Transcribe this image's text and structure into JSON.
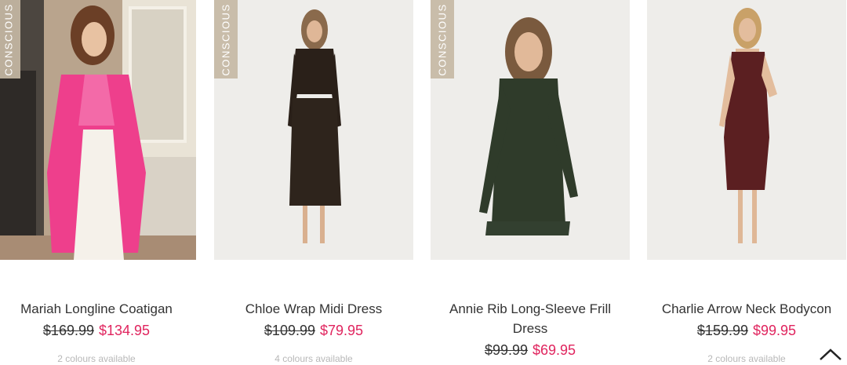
{
  "products": [
    {
      "badge": "CONSCIOUS",
      "name": "Mariah Longline Coatigan",
      "was_price": "$169.99",
      "now_price": "$134.95",
      "colours": "2 colours available",
      "image_icon": "product-photo-pink-coatigan"
    },
    {
      "badge": "CONSCIOUS",
      "name": "Chloe Wrap Midi Dress",
      "was_price": "$109.99",
      "now_price": "$79.95",
      "colours": "4 colours available",
      "image_icon": "product-photo-black-wrap-dress"
    },
    {
      "badge": "CONSCIOUS",
      "name_line1": "Annie Rib Long-Sleeve Frill",
      "name_line2": "Dress",
      "was_price": "$99.99",
      "now_price": "$69.95",
      "image_icon": "product-photo-green-frill-dress"
    },
    {
      "name": "Charlie Arrow Neck Bodycon",
      "was_price": "$159.99",
      "now_price": "$99.95",
      "colours": "2 colours available",
      "image_icon": "product-photo-burgundy-bodycon"
    }
  ],
  "colors": {
    "sale_price": "#e0245e",
    "badge_bg": "#c6b8a4",
    "text": "#333333"
  },
  "scroll_top_icon": "chevron-up-icon"
}
